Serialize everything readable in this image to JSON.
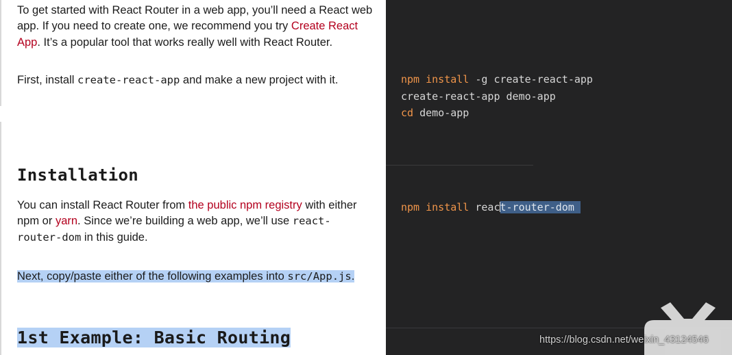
{
  "doc": {
    "intro": {
      "text_1": "To get started with React Router in a web app, you’ll need a React web app. If you need to create one, we recommend you try ",
      "link": "Create React App",
      "text_2": ". It’s a popular tool that works really well with React Router."
    },
    "first_install": {
      "text_1": "First, install ",
      "code": "create-react-app",
      "text_2": " and make a new project with it."
    },
    "installation_heading": "Installation",
    "install_para": {
      "text_1": "You can install React Router from ",
      "link_1": "the public npm registry",
      "text_2": " with either npm or ",
      "link_2": "yarn",
      "text_3": ". Since we’re building a web app, we’ll use ",
      "code": "react-router-dom",
      "text_4": " in this guide."
    },
    "next_para": {
      "text_1": "Next, copy/paste either of the following examples into ",
      "code": "src/App.js",
      "text_2": "."
    },
    "example_heading": "1st Example: Basic Routing"
  },
  "code": {
    "block1": [
      {
        "kw": "npm install",
        "rest": " -g create-react-app"
      },
      {
        "kw": "",
        "rest": "create-react-app demo-app"
      },
      {
        "kw": "cd",
        "rest": " demo-app"
      }
    ],
    "block2": {
      "kw": "npm install",
      "plain": " reac",
      "selected": "t-router-dom "
    }
  },
  "watermark": "https://blog.csdn.net/weixin_43124546",
  "colors": {
    "link": "#b3001e",
    "code_bg": "#232324",
    "keyword": "#f0954a",
    "highlight": "#b5d1f5",
    "selection": "#3f5f88"
  }
}
